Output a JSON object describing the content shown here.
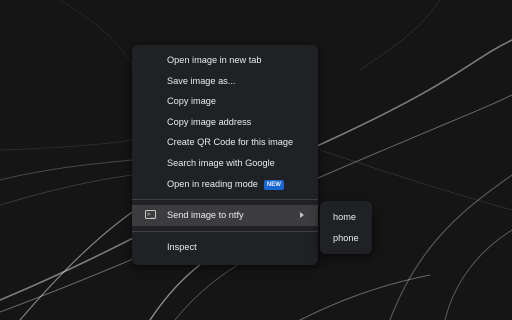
{
  "context_menu": {
    "items": [
      {
        "label": "Open image in new tab"
      },
      {
        "label": "Save image as..."
      },
      {
        "label": "Copy image"
      },
      {
        "label": "Copy image address"
      },
      {
        "label": "Create QR Code for this image"
      },
      {
        "label": "Search image with Google"
      },
      {
        "label": "Open in reading mode",
        "badge": "NEW"
      }
    ],
    "extension_item": {
      "label": "Send image to ntfy",
      "icon": "terminal-icon"
    },
    "inspect_label": "Inspect"
  },
  "submenu": {
    "items": [
      {
        "label": "home"
      },
      {
        "label": "phone"
      }
    ]
  },
  "colors": {
    "menu_bg": "#202124",
    "highlight_bg": "#3c3c3f",
    "badge_bg": "#1967d2",
    "text": "#e8eaed"
  }
}
